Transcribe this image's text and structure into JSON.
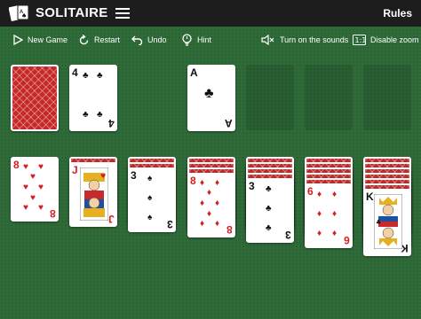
{
  "header": {
    "title": "SOLITAIRE",
    "rules": "Rules"
  },
  "toolbar": {
    "new_game": "New Game",
    "restart": "Restart",
    "undo": "Undo",
    "hint": "Hint",
    "sounds": "Turn on the sounds",
    "zoom": "Disable zoom"
  },
  "cards": {
    "waste": {
      "rank": "4",
      "suit": "♣"
    },
    "foundation1": {
      "rank": "A",
      "suit": "♣"
    },
    "t1": {
      "rank": "8",
      "suit": "♥"
    },
    "t2": {
      "rank": "J",
      "suit": "♥"
    },
    "t3": {
      "rank": "3",
      "suit": "♠"
    },
    "t4": {
      "rank": "8",
      "suit": "♦"
    },
    "t5": {
      "rank": "3",
      "suit": "♣"
    },
    "t6": {
      "rank": "6",
      "suit": "♦"
    },
    "t7": {
      "rank": "K",
      "suit": "♣"
    }
  },
  "colors": {
    "felt": "#2f6a39",
    "topbar": "#1d1d1d",
    "card_back": "#c62828",
    "red_suit": "#d32020"
  }
}
